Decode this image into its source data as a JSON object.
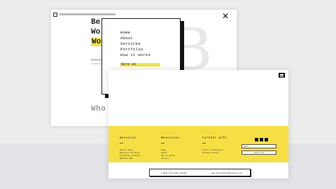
{
  "colors": {
    "accent": "#f3e14a",
    "ink": "#111111"
  },
  "back_window": {
    "hero_lines": [
      "Be",
      "Wo",
      "Wo"
    ],
    "big_letters": "B",
    "who_are_you": "Who are You?",
    "close_icon": "close-icon"
  },
  "menu": {
    "items": [
      "Home",
      "About",
      "Services",
      "Portfolio",
      "How it works"
    ],
    "cta": "Hire us"
  },
  "front_window": {
    "burger_icon": "hamburger-icon",
    "footer": {
      "columns": [
        {
          "title": "Services",
          "links": [
            "Expert Help",
            "Business Strategy",
            "Technical writing",
            "Website SEO"
          ]
        },
        {
          "title": "Resources",
          "links": [
            "Blog",
            "About",
            "How it works",
            "Careers"
          ]
        },
        {
          "title": "Further Info",
          "links": [
            "Terms & Conditions",
            "Privacy Policy"
          ]
        }
      ],
      "email_placeholder": "Email",
      "subscribe_label": "Subscribe"
    },
    "copyright_left": "© 2020 Copyright Company",
    "copyright_right": "www.copyrightcompanysite.com"
  }
}
